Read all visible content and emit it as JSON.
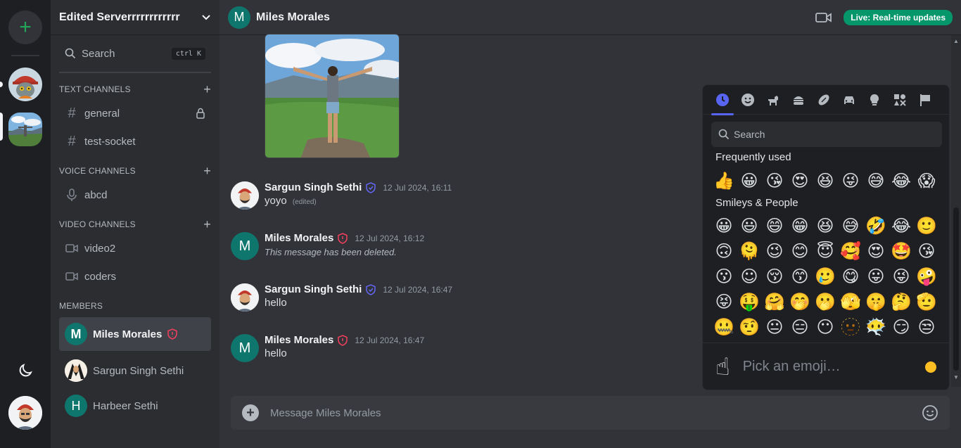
{
  "server": {
    "name": "Edited Serverrrrrrrrrrrr",
    "search_label": "Search",
    "search_shortcut": "ctrl K"
  },
  "categories": {
    "text": "TEXT CHANNELS",
    "voice": "VOICE CHANNELS",
    "video": "VIDEO CHANNELS",
    "members": "MEMBERS"
  },
  "channels": {
    "text": [
      "general",
      "test-socket"
    ],
    "voice": [
      "abcd"
    ],
    "video": [
      "video2",
      "coders"
    ]
  },
  "members": [
    {
      "name": "Miles Morales",
      "initial": "M"
    },
    {
      "name": "Sargun Singh Sethi",
      "initial": ""
    },
    {
      "name": "Harbeer Sethi",
      "initial": "H"
    }
  ],
  "header": {
    "title": "Miles Morales",
    "initial": "M",
    "live_badge": "Live: Real-time updates"
  },
  "messages": [
    {
      "author": "Sargun Singh Sethi",
      "time": "12 Jul 2024, 16:11",
      "text": "yoyo",
      "edited": "(edited)"
    },
    {
      "author": "Miles Morales",
      "initial": "M",
      "time": "12 Jul 2024, 16:12",
      "text": "This message has been deleted."
    },
    {
      "author": "Sargun Singh Sethi",
      "time": "12 Jul 2024, 16:47",
      "text": "hello"
    },
    {
      "author": "Miles Morales",
      "initial": "M",
      "time": "12 Jul 2024, 16:47",
      "text": "hello"
    }
  ],
  "composer": {
    "placeholder": "Message Miles Morales"
  },
  "emoji_picker": {
    "search_placeholder": "Search",
    "section_frequent": "Frequently used",
    "section_smileys": "Smileys & People",
    "footer_prompt": "Pick an emoji…",
    "footer_emoji": "☝",
    "frequent": [
      "👍",
      "😀",
      "😘",
      "😍",
      "😆",
      "😜",
      "😅",
      "😂",
      "😱"
    ],
    "smileys": [
      "😀",
      "😃",
      "😄",
      "😁",
      "😆",
      "😅",
      "🤣",
      "😂",
      "🙂",
      "🙃",
      "🫠",
      "😉",
      "😊",
      "😇",
      "🥰",
      "😍",
      "🤩",
      "😘",
      "😗",
      "☺",
      "😚",
      "😙",
      "🥲",
      "😋",
      "😛",
      "😜",
      "🤪",
      "😝",
      "🤑",
      "🤗",
      "🤭",
      "🫢",
      "🫣",
      "🤫",
      "🤔",
      "🫡",
      "🤐",
      "🤨",
      "😐",
      "😑",
      "😶",
      "🫥",
      "😶‍🌫️",
      "😏",
      "😒"
    ]
  }
}
